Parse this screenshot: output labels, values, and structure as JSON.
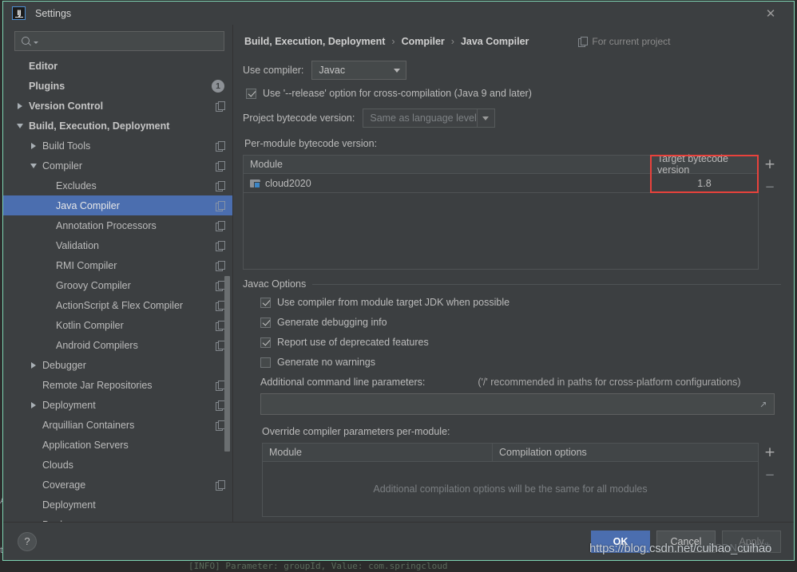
{
  "window": {
    "title": "Settings",
    "logo_text": "IJ",
    "close_icon": "close-icon"
  },
  "search": {
    "value": "",
    "placeholder": ""
  },
  "sidebar": {
    "items": [
      {
        "label": "Editor",
        "arrow": "none",
        "indent": 0,
        "bold": true,
        "copy": false,
        "badge": null,
        "selected": false
      },
      {
        "label": "Plugins",
        "arrow": "none",
        "indent": 0,
        "bold": true,
        "copy": false,
        "badge": "1",
        "selected": false
      },
      {
        "label": "Version Control",
        "arrow": "right",
        "indent": 0,
        "bold": true,
        "copy": true,
        "badge": null,
        "selected": false
      },
      {
        "label": "Build, Execution, Deployment",
        "arrow": "down",
        "indent": 0,
        "bold": true,
        "copy": false,
        "badge": null,
        "selected": false
      },
      {
        "label": "Build Tools",
        "arrow": "right",
        "indent": 1,
        "bold": false,
        "copy": true,
        "badge": null,
        "selected": false
      },
      {
        "label": "Compiler",
        "arrow": "down",
        "indent": 1,
        "bold": false,
        "copy": true,
        "badge": null,
        "selected": false
      },
      {
        "label": "Excludes",
        "arrow": "none",
        "indent": 2,
        "bold": false,
        "copy": true,
        "badge": null,
        "selected": false
      },
      {
        "label": "Java Compiler",
        "arrow": "none",
        "indent": 2,
        "bold": false,
        "copy": true,
        "badge": null,
        "selected": true
      },
      {
        "label": "Annotation Processors",
        "arrow": "none",
        "indent": 2,
        "bold": false,
        "copy": true,
        "badge": null,
        "selected": false
      },
      {
        "label": "Validation",
        "arrow": "none",
        "indent": 2,
        "bold": false,
        "copy": true,
        "badge": null,
        "selected": false
      },
      {
        "label": "RMI Compiler",
        "arrow": "none",
        "indent": 2,
        "bold": false,
        "copy": true,
        "badge": null,
        "selected": false
      },
      {
        "label": "Groovy Compiler",
        "arrow": "none",
        "indent": 2,
        "bold": false,
        "copy": true,
        "badge": null,
        "selected": false
      },
      {
        "label": "ActionScript & Flex Compiler",
        "arrow": "none",
        "indent": 2,
        "bold": false,
        "copy": true,
        "badge": null,
        "selected": false
      },
      {
        "label": "Kotlin Compiler",
        "arrow": "none",
        "indent": 2,
        "bold": false,
        "copy": true,
        "badge": null,
        "selected": false
      },
      {
        "label": "Android Compilers",
        "arrow": "none",
        "indent": 2,
        "bold": false,
        "copy": true,
        "badge": null,
        "selected": false
      },
      {
        "label": "Debugger",
        "arrow": "right",
        "indent": 1,
        "bold": false,
        "copy": false,
        "badge": null,
        "selected": false
      },
      {
        "label": "Remote Jar Repositories",
        "arrow": "none",
        "indent": 1,
        "bold": false,
        "copy": true,
        "badge": null,
        "selected": false
      },
      {
        "label": "Deployment",
        "arrow": "right",
        "indent": 1,
        "bold": false,
        "copy": true,
        "badge": null,
        "selected": false
      },
      {
        "label": "Arquillian Containers",
        "arrow": "none",
        "indent": 1,
        "bold": false,
        "copy": true,
        "badge": null,
        "selected": false
      },
      {
        "label": "Application Servers",
        "arrow": "none",
        "indent": 1,
        "bold": false,
        "copy": false,
        "badge": null,
        "selected": false
      },
      {
        "label": "Clouds",
        "arrow": "none",
        "indent": 1,
        "bold": false,
        "copy": false,
        "badge": null,
        "selected": false
      },
      {
        "label": "Coverage",
        "arrow": "none",
        "indent": 1,
        "bold": false,
        "copy": true,
        "badge": null,
        "selected": false
      },
      {
        "label": "Deployment",
        "arrow": "none",
        "indent": 1,
        "bold": false,
        "copy": false,
        "badge": null,
        "selected": false
      },
      {
        "label": "Docker",
        "arrow": "right",
        "indent": 1,
        "bold": false,
        "copy": false,
        "badge": null,
        "selected": false
      }
    ]
  },
  "content": {
    "breadcrumb": [
      "Build, Execution, Deployment",
      "Compiler",
      "Java Compiler"
    ],
    "breadcrumb_separator": "›",
    "for_current_project": "For current project",
    "use_compiler_label": "Use compiler:",
    "use_compiler_value": "Javac",
    "release_option_label": "Use '--release' option for cross-compilation (Java 9 and later)",
    "release_option_checked": true,
    "project_bytecode_label": "Project bytecode version:",
    "project_bytecode_value": "Same as language level",
    "per_module_label": "Per-module bytecode version:",
    "per_module_table": {
      "columns": [
        "Module",
        "Target bytecode version"
      ],
      "rows": [
        {
          "module": "cloud2020",
          "target": "1.8"
        }
      ],
      "add_label": "+",
      "remove_label": "−",
      "highlight_color": "#e8423c"
    },
    "javac_options": {
      "title": "Javac Options",
      "checkboxes": [
        {
          "label": "Use compiler from module target JDK when possible",
          "checked": true
        },
        {
          "label": "Generate debugging info",
          "checked": true
        },
        {
          "label": "Report use of deprecated features",
          "checked": true
        },
        {
          "label": "Generate no warnings",
          "checked": false
        }
      ],
      "additional_params_label": "Additional command line parameters:",
      "additional_params_note": "('/' recommended in paths for cross-platform configurations)",
      "additional_params_value": ""
    },
    "override_label": "Override compiler parameters per-module:",
    "override_table": {
      "columns": [
        "Module",
        "Compilation options"
      ],
      "empty_text": "Additional compilation options will be the same for all modules",
      "add_label": "+",
      "remove_label": "−"
    }
  },
  "footer": {
    "help_label": "?",
    "ok_label": "OK",
    "cancel_label": "Cancel",
    "apply_label": "Apply"
  },
  "watermark": {
    "url": "https://blog.csdn.net/cuihao_cuihao",
    "cn": "CSDN @崔浩"
  },
  "background": {
    "console_line": "[INFO] Parameter: groupId, Value: com.springcloud",
    "left_fragment_a": "A",
    "left_fragment_b": "tc"
  },
  "colors": {
    "selection_blue": "#4b6eaf",
    "dialog_bg": "#3c3f41",
    "highlight_red": "#e8423c",
    "dialog_border": "#7fd6b4"
  }
}
